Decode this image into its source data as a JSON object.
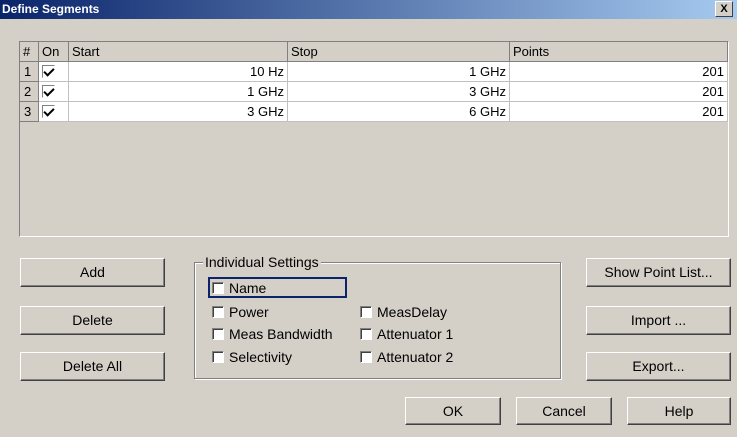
{
  "window": {
    "title": "Define Segments",
    "close_label": "X"
  },
  "table": {
    "columns": [
      "#",
      "On",
      "Start",
      "Stop",
      "Points"
    ],
    "rows": [
      {
        "num": "1",
        "on": true,
        "start": "10 Hz",
        "stop": "1 GHz",
        "points": "201"
      },
      {
        "num": "2",
        "on": true,
        "start": "1 GHz",
        "stop": "3 GHz",
        "points": "201"
      },
      {
        "num": "3",
        "on": true,
        "start": "3 GHz",
        "stop": "6 GHz",
        "points": "201"
      }
    ]
  },
  "buttons": {
    "add": "Add",
    "delete": "Delete",
    "delete_all": "Delete All",
    "show_point_list": "Show Point List...",
    "import": "Import ...",
    "export": "Export...",
    "ok": "OK",
    "cancel": "Cancel",
    "help": "Help"
  },
  "settings": {
    "group_label": "Individual Settings",
    "name": "Name",
    "power": "Power",
    "meas_bandwidth": "Meas Bandwidth",
    "selectivity": "Selectivity",
    "meas_delay": "MeasDelay",
    "attenuator1": "Attenuator 1",
    "attenuator2": "Attenuator 2"
  }
}
